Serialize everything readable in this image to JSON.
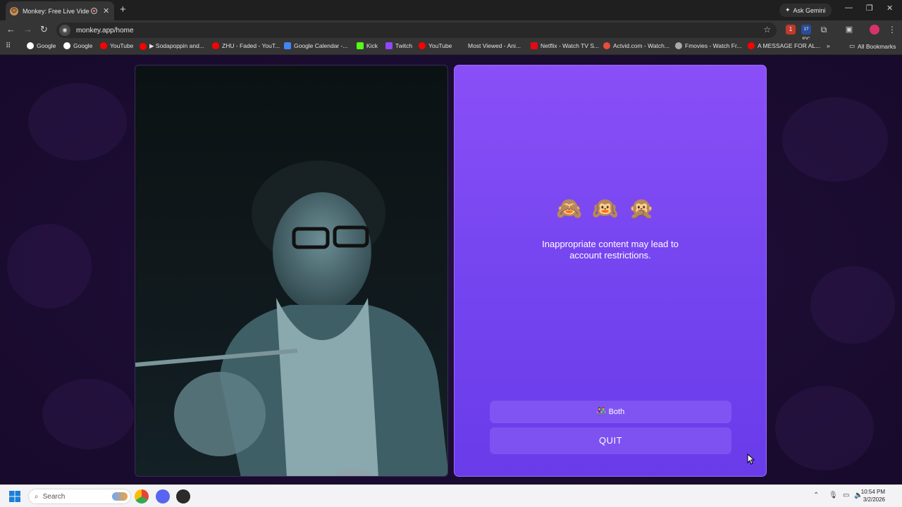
{
  "browser": {
    "tab_title": "Monkey: Free Live Video Chat",
    "new_tab": "+",
    "gemini_label": "Ask Gemini",
    "url": "monkey.app/home",
    "ext_badge": "1",
    "ext_badge2": "1?fGC",
    "bookmarks": [
      {
        "label": "Google",
        "color": "#ffffff"
      },
      {
        "label": "Google",
        "color": "#ffffff"
      },
      {
        "label": "YouTube",
        "color": "#ff0000"
      },
      {
        "label": "▶ Sodapoppin and...",
        "color": "#ff0000"
      },
      {
        "label": "ZHU - Faded - YouT...",
        "color": "#ff0000"
      },
      {
        "label": "Google Calendar -...",
        "color": "#4285f4"
      },
      {
        "label": "Kick",
        "color": "#53fc18"
      },
      {
        "label": "Twitch",
        "color": "#9146ff"
      },
      {
        "label": "YouTube",
        "color": "#ff0000"
      },
      {
        "label": "Most Viewed - Ani...",
        "color": "#353535"
      },
      {
        "label": "Netflix - Watch TV S...",
        "color": "#e50914"
      },
      {
        "label": "Actvid.com - Watch...",
        "color": "#e84c3d"
      },
      {
        "label": "Fmovies - Watch Fr...",
        "color": "#aaaaaa"
      },
      {
        "label": "A MESSAGE FOR AL...",
        "color": "#ff0000"
      }
    ],
    "bookmarks_more": "»",
    "all_bookmarks": "All Bookmarks"
  },
  "panel": {
    "emojis": "🙈🙉🙊",
    "notice_line1": "Inappropriate content may lead to",
    "notice_line2": "account restrictions.",
    "both_label": "Both",
    "both_icon": "👫",
    "quit_label": "QUIT",
    "panel_color": "#7a47f2"
  },
  "taskbar": {
    "search_placeholder": "Search",
    "time": "10:54 PM",
    "date": "3/2/2026"
  }
}
